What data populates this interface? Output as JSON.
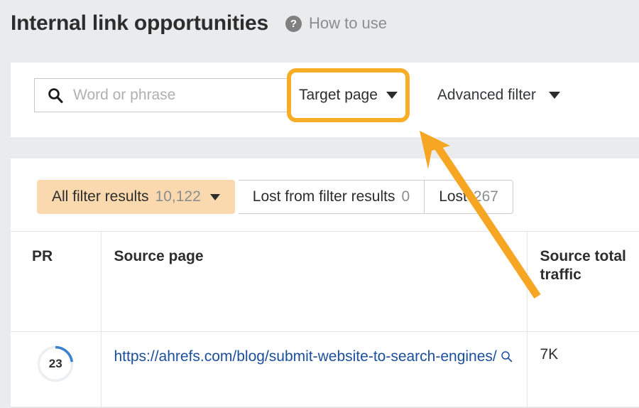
{
  "header": {
    "title": "Internal link opportunities",
    "help_icon": "question-mark-icon",
    "help_label": "How to use"
  },
  "filters": {
    "search": {
      "icon": "search-icon",
      "value": "",
      "placeholder": "Word or phrase"
    },
    "target_page": {
      "label": "Target page",
      "caret": "chevron-down-icon",
      "highlighted": true,
      "highlight_color": "#f7ad26"
    },
    "advanced_filter": {
      "label": "Advanced filter",
      "caret": "chevron-down-icon"
    }
  },
  "tabs": [
    {
      "label": "All filter results",
      "count": "10,122",
      "active": true,
      "has_caret": true
    },
    {
      "label": "Lost from filter results",
      "count": "0",
      "active": false,
      "has_caret": false
    },
    {
      "label": "Lost",
      "count": "267",
      "active": false,
      "has_caret": false
    }
  ],
  "table": {
    "columns": [
      {
        "key": "pr",
        "label": "PR"
      },
      {
        "key": "source_page",
        "label": "Source page"
      },
      {
        "key": "source_total_traffic",
        "label": "Source total traffic"
      }
    ],
    "rows": [
      {
        "pr": "23",
        "pr_percent": 23,
        "source_page": "https://ahrefs.com/blog/submit-website-to-search-engines/",
        "source_page_icon": "magnifier-icon",
        "source_total_traffic": "7K"
      }
    ]
  },
  "annotation": {
    "type": "arrow",
    "color": "#f7a623",
    "points_to": "target-page-dropdown"
  },
  "colors": {
    "page_background": "#eaebec",
    "panel_background": "#ffffff",
    "accent_orange": "#f7ad26",
    "active_tab_background": "#fbd9ae",
    "link_blue": "#1b4f9c",
    "progress_blue": "#3b82d0",
    "progress_track": "#eceef0",
    "text_primary": "#2d2d2d",
    "text_muted": "#8a8d90"
  }
}
